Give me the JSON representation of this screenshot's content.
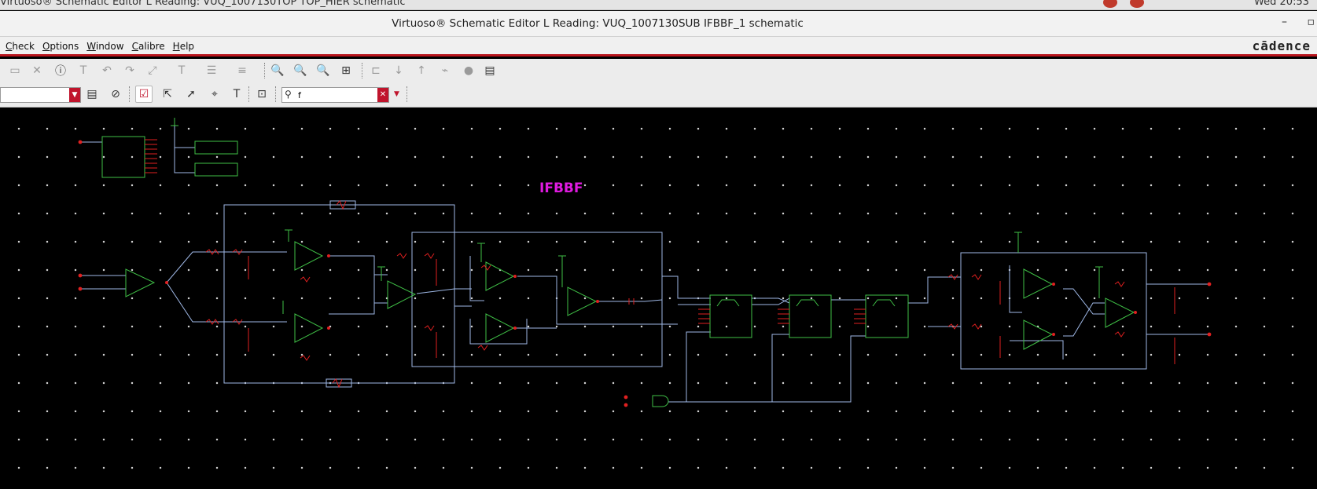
{
  "system_bar": {
    "background_title": "Virtuoso® Schematic Editor L Reading: VUQ_1007130TOP TOP_HIER schematic",
    "clock": "Wed 20:53"
  },
  "window": {
    "title": "Virtuoso® Schematic Editor L Reading: VUQ_1007130SUB IFBBF_1 schematic",
    "minimize": "–",
    "maximize": "▫"
  },
  "menubar": {
    "items": [
      "Check",
      "Options",
      "Window",
      "Calibre",
      "Help"
    ],
    "brand": "cādence"
  },
  "toolbar2": {
    "search_value": "f"
  },
  "canvas": {
    "cell_label": "IFBBF",
    "wire_color": "#9fb8e6",
    "symbol_color": "#3fbf46",
    "pin_color": "#e02020",
    "label_color": "#e01ae0"
  },
  "colors": {
    "accent": "#b8141c"
  }
}
